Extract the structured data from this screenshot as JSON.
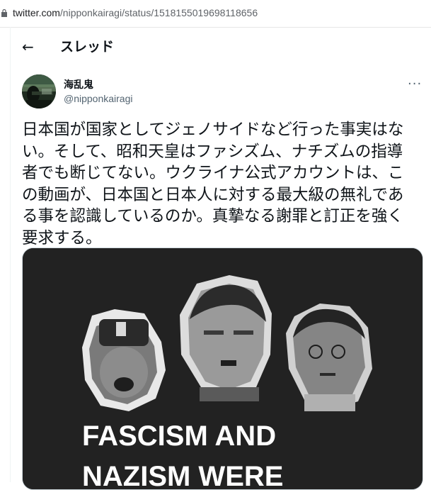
{
  "browser": {
    "url_host": "twitter.com",
    "url_path": "/nipponkairagi/status/1518155019698118656"
  },
  "header": {
    "back_icon": "←",
    "title": "スレッド"
  },
  "tweet": {
    "author_name": "海乱鬼",
    "author_handle": "@nipponkairagi",
    "more_icon": "···",
    "text_lines": [
      "日本国が国家としてジェノサイドなど行った事実はな",
      "い。そして、昭和天皇はファシズム、ナチズムの指導",
      "者でも断じてない。ウクライナ公式アカウントは、こ",
      "の動画が、日本国と日本人に対する最大級の無礼であ",
      "る事を認識しているのか。真摯なる謝罪と訂正を強く",
      "要求する。"
    ],
    "media": {
      "overlay_line_1": "FASCISM AND",
      "overlay_line_2": "NAZISM WERE"
    }
  }
}
